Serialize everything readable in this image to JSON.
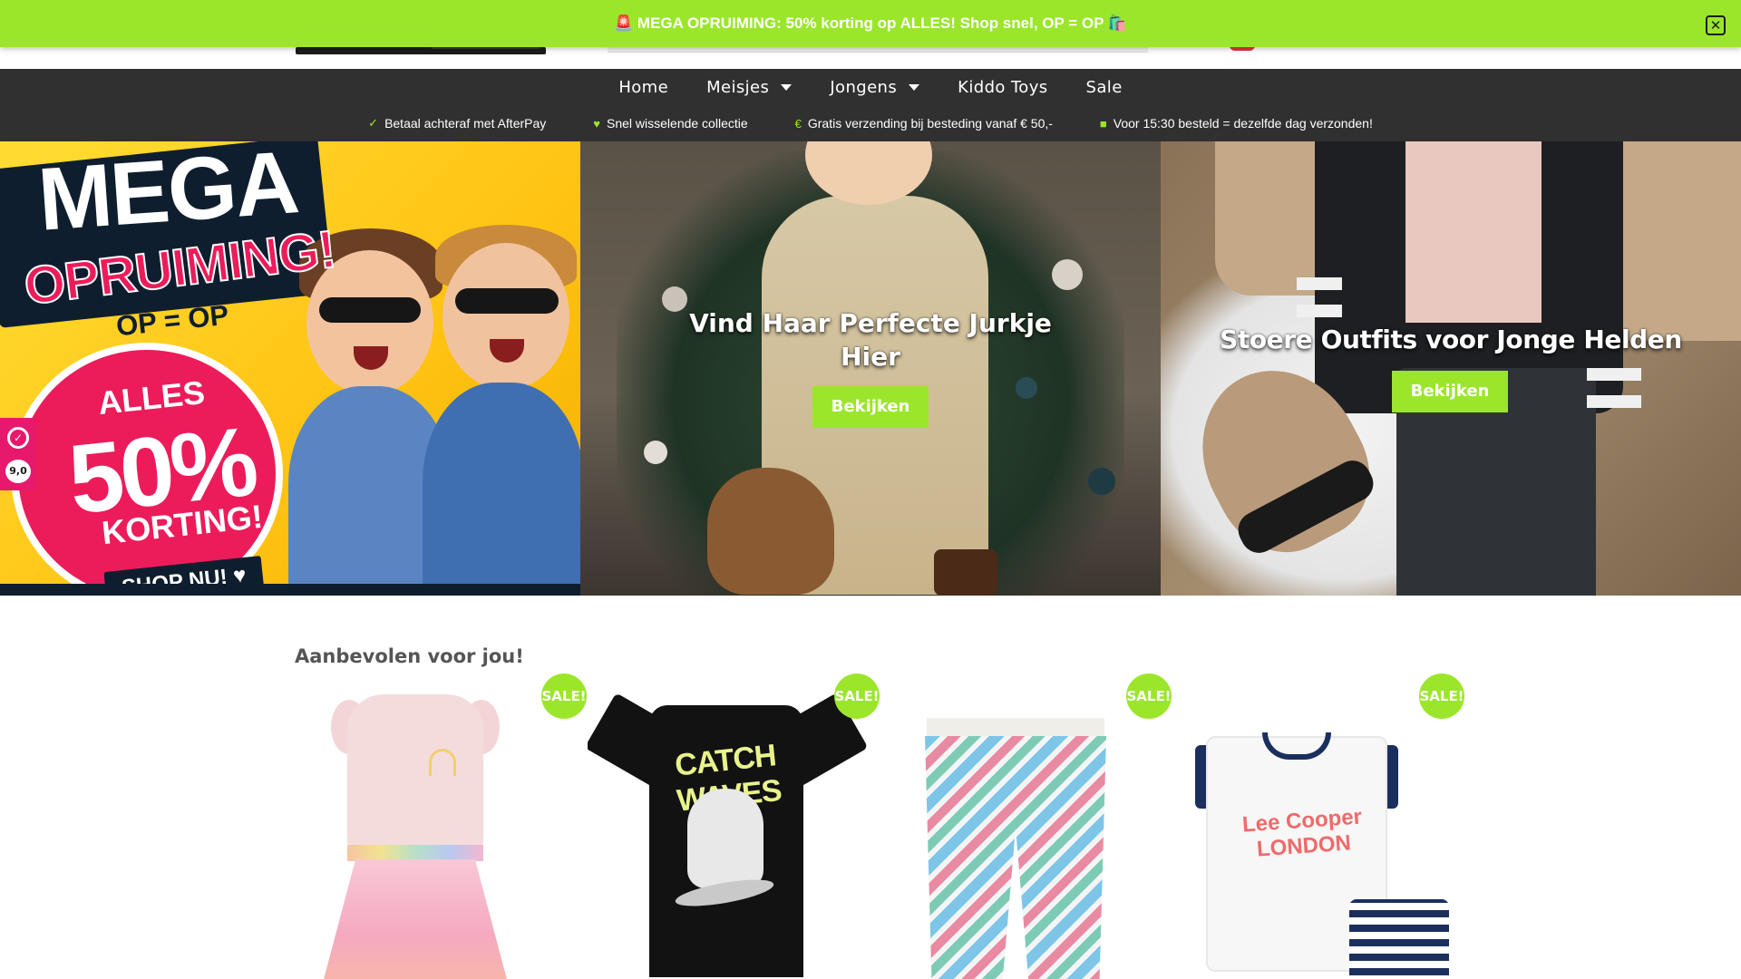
{
  "promo": {
    "text": "🚨 MEGA OPRUIMING: 50% korting op ALLES! Shop snel, OP = OP 🛍️",
    "close_icon": "close-icon"
  },
  "nav": {
    "items": [
      {
        "label": "Home",
        "has_dropdown": false
      },
      {
        "label": "Meisjes",
        "has_dropdown": true
      },
      {
        "label": "Jongens",
        "has_dropdown": true
      },
      {
        "label": "Kiddo Toys",
        "has_dropdown": false
      },
      {
        "label": "Sale",
        "has_dropdown": false
      }
    ]
  },
  "usp": {
    "items": [
      {
        "icon": "check-icon",
        "glyph": "✓",
        "label": "Betaal achteraf met AfterPay"
      },
      {
        "icon": "heart-icon",
        "glyph": "♥",
        "label": "Snel wisselende collectie"
      },
      {
        "icon": "euro-icon",
        "glyph": "€",
        "label": "Gratis verzending bij besteding vanaf € 50,-"
      },
      {
        "icon": "truck-icon",
        "glyph": "■",
        "label": "Voor 15:30 besteld = dezelfde dag verzonden!"
      }
    ]
  },
  "hero": {
    "banner": {
      "headline": "MEGA",
      "subheadline": "OPRUIMING!",
      "tagline": "OP = OP",
      "alles": "ALLES",
      "percent": "50%",
      "korting": "KORTING!",
      "shop": "SHOP NU! ♥"
    },
    "girls": {
      "title": "Vind Haar Perfecte Jurkje Hier",
      "button": "Bekijken"
    },
    "boys": {
      "title": "Stoere Outfits voor Jonge Helden",
      "button": "Bekijken"
    }
  },
  "review_badge": {
    "score": "9,0"
  },
  "recommended": {
    "title": "Aanbevolen voor jou!",
    "products": [
      {
        "badge": "SALE!",
        "image": "pink-rainbow-dress"
      },
      {
        "badge": "SALE!",
        "image": "black-catch-waves-tshirt",
        "print": "CATCH WAVES"
      },
      {
        "badge": "SALE!",
        "image": "zigzag-leggings"
      },
      {
        "badge": "SALE!",
        "image": "lee-cooper-london-set",
        "print": "Lee Cooper LONDON"
      }
    ]
  },
  "colors": {
    "brand_green": "#9be62b",
    "nav_dark": "#303030",
    "banner_pink": "#ec1c5a",
    "banner_yellow": "#ffcc1d"
  }
}
